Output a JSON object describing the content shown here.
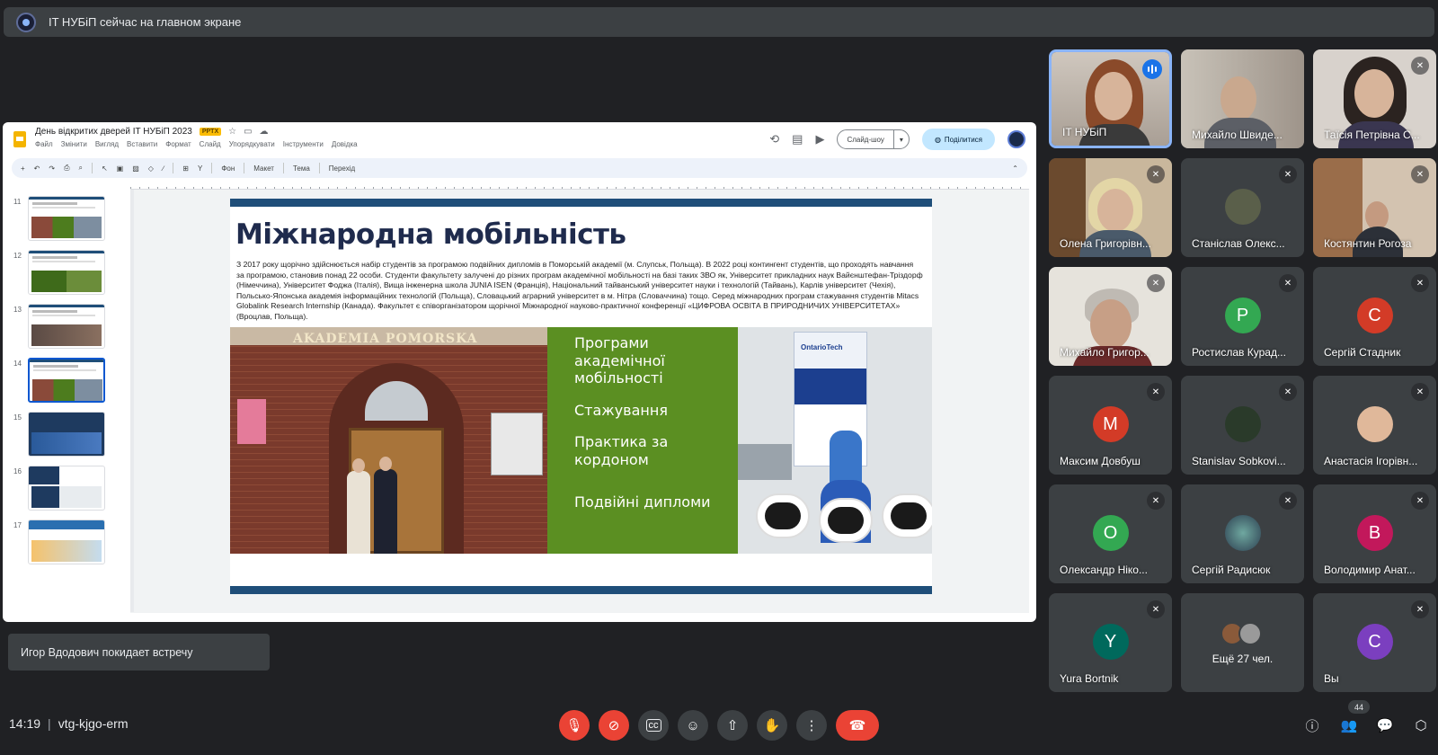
{
  "banner": {
    "text": "IT НУБіП сейчас на главном экране"
  },
  "slides_app": {
    "doc_title": "День відкритих дверей IT НУБіП 2023",
    "badge": "PPTX",
    "menu": [
      "Файл",
      "Змінити",
      "Вигляд",
      "Вставити",
      "Формат",
      "Слайд",
      "Упорядкувати",
      "Інструменти",
      "Довідка"
    ],
    "slideshow_label": "Слайд-шоу",
    "share_label": "Поділитися",
    "toolbar": [
      "Фон",
      "Макет",
      "Тема",
      "Перехід"
    ],
    "thumbnails": [
      {
        "num": "11"
      },
      {
        "num": "12"
      },
      {
        "num": "13"
      },
      {
        "num": "14"
      },
      {
        "num": "15"
      },
      {
        "num": "16"
      },
      {
        "num": "17"
      }
    ]
  },
  "slide": {
    "title": "Міжнародна мобільність",
    "body": "З 2017 року щорічно здійснюється набір студентів за програмою подвійних дипломів в Поморській академії (м. Слупськ, Польща). В 2022 році контингент студентів, що проходять навчання за програмою, становив понад 22 особи. Студенти факультету залучені до різних програм академічної мобільності на базі таких ЗВО як, Університет прикладних наук Вайєнштефан-Тріздорф (Німеччина), Університет Фоджа (Італія), Вища інженерна школа JUNIA ISEN (Франція), Національний тайванський університет науки і технологій (Тайвань), Карлів університет (Чехія), Польсько-Японська академія інформаційних технологій (Польща), Словацький аграрний університет в м. Нітра (Словаччина) тощо. Серед міжнародних програм стажування студентів Mitacs Globalink Research Internship (Канада). Факультет є співорганізатором щорічної Міжнародної науково-практичної конференції «ЦИФРОВА ОСВІТА В ПРИРОДНИЧИХ УНІВЕРСИТЕТАХ» (Вроцлав, Польща).",
    "photo_sign": "AKADEMIA POMORSKA",
    "green_items": [
      "Програми\nакадемічної\nмобільності",
      "Стажування",
      "Практика за\nкордоном",
      "Подвійні дипломи"
    ],
    "banner_brand": "OntarioTech"
  },
  "notification": "Игор Вдодович покидает встречу",
  "participants": [
    {
      "name": "IT НУБіП",
      "kind": "video",
      "speaking": true
    },
    {
      "name": "Михайло Швиде...",
      "kind": "video",
      "speaking": false
    },
    {
      "name": "Таїсія Петрівна С...",
      "kind": "video",
      "speaking": false
    },
    {
      "name": "Олена Григорівн...",
      "kind": "video",
      "speaking": false
    },
    {
      "name": "Станіслав Олекс...",
      "kind": "photo",
      "speaking": false
    },
    {
      "name": "Костянтин Рогоза",
      "kind": "video",
      "speaking": false
    },
    {
      "name": "Михайло Григор...",
      "kind": "video",
      "speaking": false
    },
    {
      "name": "Ростислав Курад...",
      "kind": "letter",
      "letter": "Р",
      "color": "#33a852"
    },
    {
      "name": "Сергій Стадник",
      "kind": "letter",
      "letter": "С",
      "color": "#d33b27"
    },
    {
      "name": "Максим Довбуш",
      "kind": "letter",
      "letter": "М",
      "color": "#d33b27"
    },
    {
      "name": "Stanislav Sobkovi...",
      "kind": "photo",
      "speaking": false
    },
    {
      "name": "Анастасія Ігорівн...",
      "kind": "photo",
      "speaking": false
    },
    {
      "name": "Олександр Ніко...",
      "kind": "letter",
      "letter": "О",
      "color": "#33a852"
    },
    {
      "name": "Сергій Радисюк",
      "kind": "photo",
      "speaking": false
    },
    {
      "name": "Володимир Анат...",
      "kind": "letter",
      "letter": "В",
      "color": "#c2185b"
    },
    {
      "name": "Yura Bortnik",
      "kind": "letter",
      "letter": "Y",
      "color": "#00695c"
    },
    {
      "name": "Ещё 27 чел.",
      "kind": "more"
    },
    {
      "name": "Вы",
      "kind": "letter",
      "letter": "C",
      "color": "#7b3fbf"
    }
  ],
  "bottom": {
    "time": "14:19",
    "meeting_code": "vtg-kjgo-erm",
    "people_count": "44"
  },
  "icons": [
    "mic-off-icon",
    "camera-off-icon",
    "captions-icon",
    "emoji-icon",
    "present-icon",
    "raise-hand-icon",
    "more-icon",
    "end-call-icon",
    "info-icon",
    "people-icon",
    "chat-icon",
    "activities-icon"
  ]
}
